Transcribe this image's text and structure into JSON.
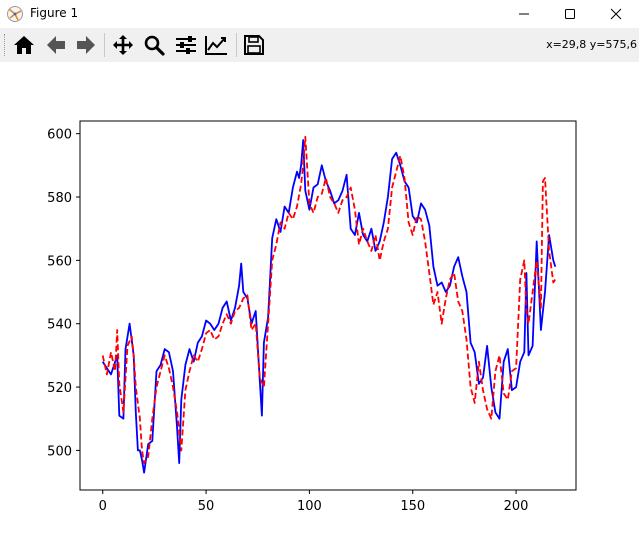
{
  "window": {
    "title": "Figure 1",
    "controls": [
      "minimize",
      "maximize",
      "close"
    ]
  },
  "toolbar": {
    "buttons": [
      {
        "name": "home",
        "icon": "home-icon"
      },
      {
        "name": "back",
        "icon": "arrow-left-icon"
      },
      {
        "name": "forward",
        "icon": "arrow-right-icon"
      },
      {
        "name": "pan",
        "icon": "move-icon"
      },
      {
        "name": "zoom",
        "icon": "magnifier-icon"
      },
      {
        "name": "configure-subplots",
        "icon": "sliders-icon"
      },
      {
        "name": "edit-axis",
        "icon": "chart-line-icon"
      },
      {
        "name": "save",
        "icon": "floppy-disk-icon"
      }
    ],
    "coordinates": "x=29,8 y=575,6"
  },
  "chart_data": {
    "type": "line",
    "title": "",
    "xlabel": "",
    "ylabel": "",
    "xlim": [
      -11,
      229
    ],
    "ylim": [
      487.5,
      604
    ],
    "xticks": [
      0,
      50,
      100,
      150,
      200
    ],
    "yticks": [
      500,
      520,
      540,
      560,
      580,
      600
    ],
    "grid": false,
    "series": [
      {
        "style": "solid",
        "color": "#0000ff",
        "x": [
          0,
          4,
          7,
          8,
          10,
          11,
          13,
          15,
          16,
          17,
          18,
          19,
          20,
          22,
          24,
          26,
          28,
          30,
          32,
          34,
          36,
          37,
          38,
          40,
          42,
          44,
          46,
          48,
          50,
          52,
          54,
          56,
          58,
          60,
          62,
          64,
          66,
          67,
          68,
          70,
          72,
          74,
          76,
          77,
          78,
          80,
          82,
          84,
          86,
          88,
          90,
          92,
          94,
          95,
          96,
          97,
          98,
          100,
          102,
          104,
          106,
          108,
          110,
          112,
          114,
          116,
          118,
          120,
          122,
          124,
          126,
          128,
          130,
          132,
          134,
          136,
          138,
          140,
          142,
          144,
          146,
          148,
          150,
          152,
          154,
          156,
          158,
          160,
          162,
          164,
          166,
          168,
          170,
          172,
          174,
          176,
          178,
          180,
          182,
          184,
          186,
          188,
          190,
          192,
          194,
          196,
          198,
          200,
          202,
          204,
          205,
          206,
          208,
          210,
          212,
          214,
          216,
          218,
          219
        ],
        "y": [
          528,
          524,
          530,
          511,
          510,
          532,
          540,
          530,
          512,
          500,
          500,
          497,
          493,
          502,
          503,
          525,
          527,
          532,
          531,
          525,
          507,
          496,
          516,
          527,
          532,
          528,
          534,
          536,
          541,
          540,
          538,
          540,
          545,
          547,
          541,
          545,
          552,
          559,
          550,
          548,
          540,
          544,
          522,
          511,
          534,
          542,
          567,
          573,
          569,
          577,
          575,
          583,
          588,
          586,
          590,
          598,
          582,
          576,
          583,
          584,
          590,
          585,
          582,
          578,
          579,
          582,
          587,
          570,
          568,
          575,
          568,
          566,
          570,
          563,
          566,
          572,
          580,
          592,
          594,
          590,
          585,
          583,
          574,
          572,
          578,
          576,
          571,
          558,
          552,
          553,
          550,
          552,
          558,
          561,
          555,
          550,
          534,
          531,
          521,
          523,
          533,
          520,
          512,
          510,
          528,
          532,
          519,
          520,
          528,
          531,
          556,
          530,
          533,
          566,
          538,
          550,
          568,
          560,
          558
        ]
      },
      {
        "style": "dashed",
        "color": "#ff0000",
        "x": [
          0,
          2,
          4,
          6,
          7,
          8,
          10,
          12,
          14,
          15,
          16,
          18,
          19,
          20,
          22,
          24,
          26,
          28,
          30,
          32,
          34,
          36,
          38,
          40,
          42,
          44,
          46,
          48,
          50,
          52,
          54,
          56,
          58,
          60,
          62,
          64,
          66,
          68,
          70,
          72,
          74,
          76,
          78,
          80,
          82,
          84,
          86,
          88,
          90,
          92,
          94,
          96,
          97,
          98,
          100,
          102,
          104,
          106,
          108,
          110,
          112,
          114,
          116,
          118,
          120,
          122,
          124,
          126,
          128,
          130,
          132,
          134,
          136,
          138,
          140,
          142,
          144,
          146,
          148,
          150,
          152,
          154,
          156,
          158,
          160,
          162,
          164,
          166,
          168,
          170,
          172,
          174,
          176,
          178,
          180,
          182,
          184,
          186,
          188,
          190,
          192,
          194,
          196,
          198,
          200,
          202,
          204,
          205,
          206,
          208,
          210,
          212,
          213,
          214,
          216,
          218,
          219
        ],
        "y": [
          530,
          524,
          531,
          525,
          538,
          521,
          512,
          533,
          536,
          530,
          520,
          510,
          500,
          496,
          498,
          510,
          520,
          525,
          530,
          526,
          520,
          512,
          500,
          519,
          525,
          530,
          528,
          532,
          537,
          538,
          535,
          536,
          540,
          543,
          540,
          544,
          545,
          548,
          549,
          538,
          540,
          523,
          520,
          540,
          560,
          565,
          572,
          570,
          575,
          573,
          577,
          584,
          590,
          599,
          578,
          575,
          580,
          581,
          586,
          580,
          578,
          575,
          579,
          580,
          583,
          576,
          565,
          570,
          566,
          563,
          568,
          560,
          566,
          570,
          583,
          588,
          593,
          586,
          572,
          568,
          574,
          573,
          566,
          556,
          546,
          550,
          540,
          548,
          554,
          556,
          547,
          544,
          535,
          520,
          515,
          528,
          519,
          513,
          510,
          525,
          530,
          518,
          516,
          525,
          526,
          554,
          560,
          544,
          540,
          550,
          560,
          545,
          585,
          586,
          563,
          553,
          554
        ]
      }
    ]
  }
}
